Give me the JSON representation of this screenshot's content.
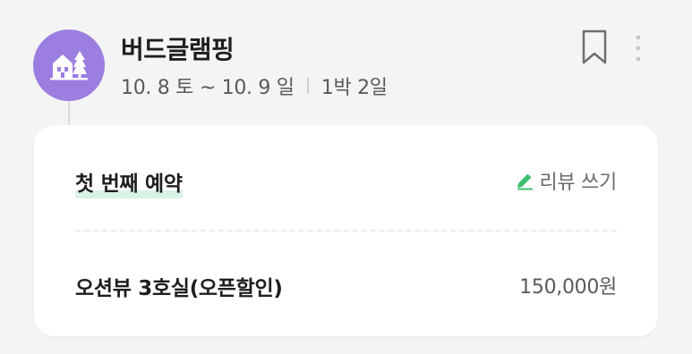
{
  "reservation": {
    "place_name": "버드글램핑",
    "dates": "10. 8 토 ~ 10. 9 일",
    "duration": "1박 2일",
    "avatar_icon": "camping-house-trees-icon",
    "avatar_color": "#9b7ee0"
  },
  "actions": {
    "bookmark_icon": "bookmark-icon",
    "more_icon": "more-vertical-icon"
  },
  "card": {
    "booking_label": "첫 번째 예약",
    "review_label": "리뷰 쓰기",
    "review_icon": "pencil-icon",
    "review_icon_color": "#3fbf6d",
    "room_name": "오션뷰 3호실(오픈할인)",
    "price": "150,000원"
  }
}
